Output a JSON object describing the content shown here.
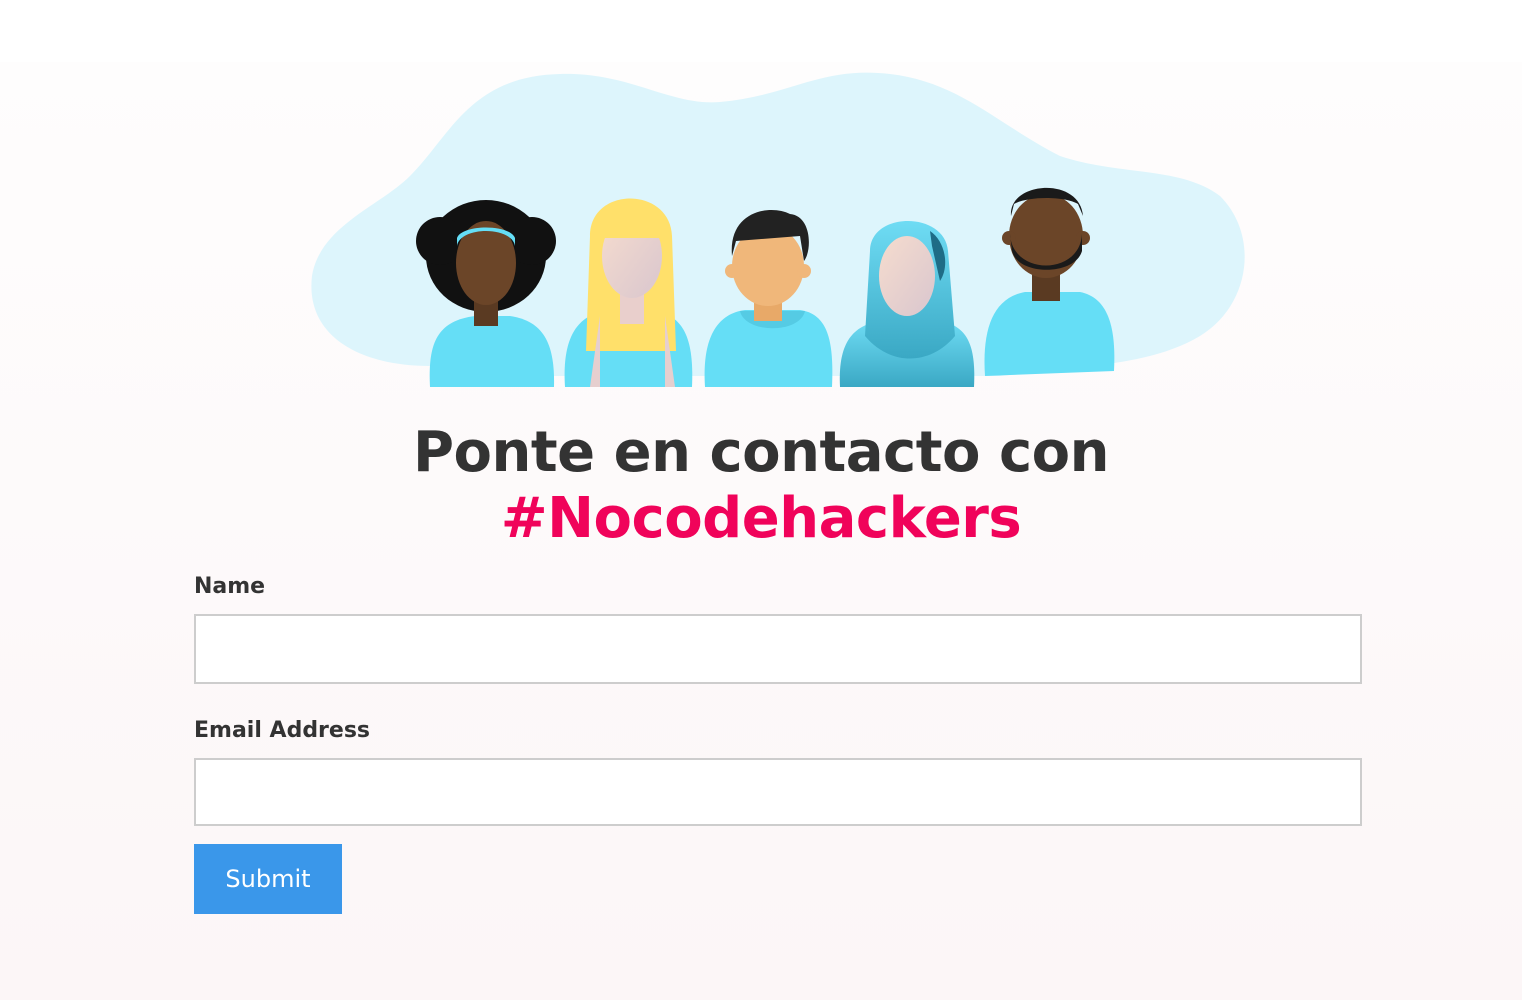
{
  "hero": {
    "illustration": "five-diverse-people-illustration",
    "blob_color": "#ddf5fc",
    "shirt_color": "#65def6"
  },
  "heading": {
    "line1": "Ponte en contacto con",
    "line2": "#Nocodehackers",
    "brand_color": "#f0035a"
  },
  "form": {
    "name_label": "Name",
    "name_value": "",
    "email_label": "Email Address",
    "email_value": "",
    "submit_label": "Submit",
    "submit_color": "#3a97ea"
  }
}
